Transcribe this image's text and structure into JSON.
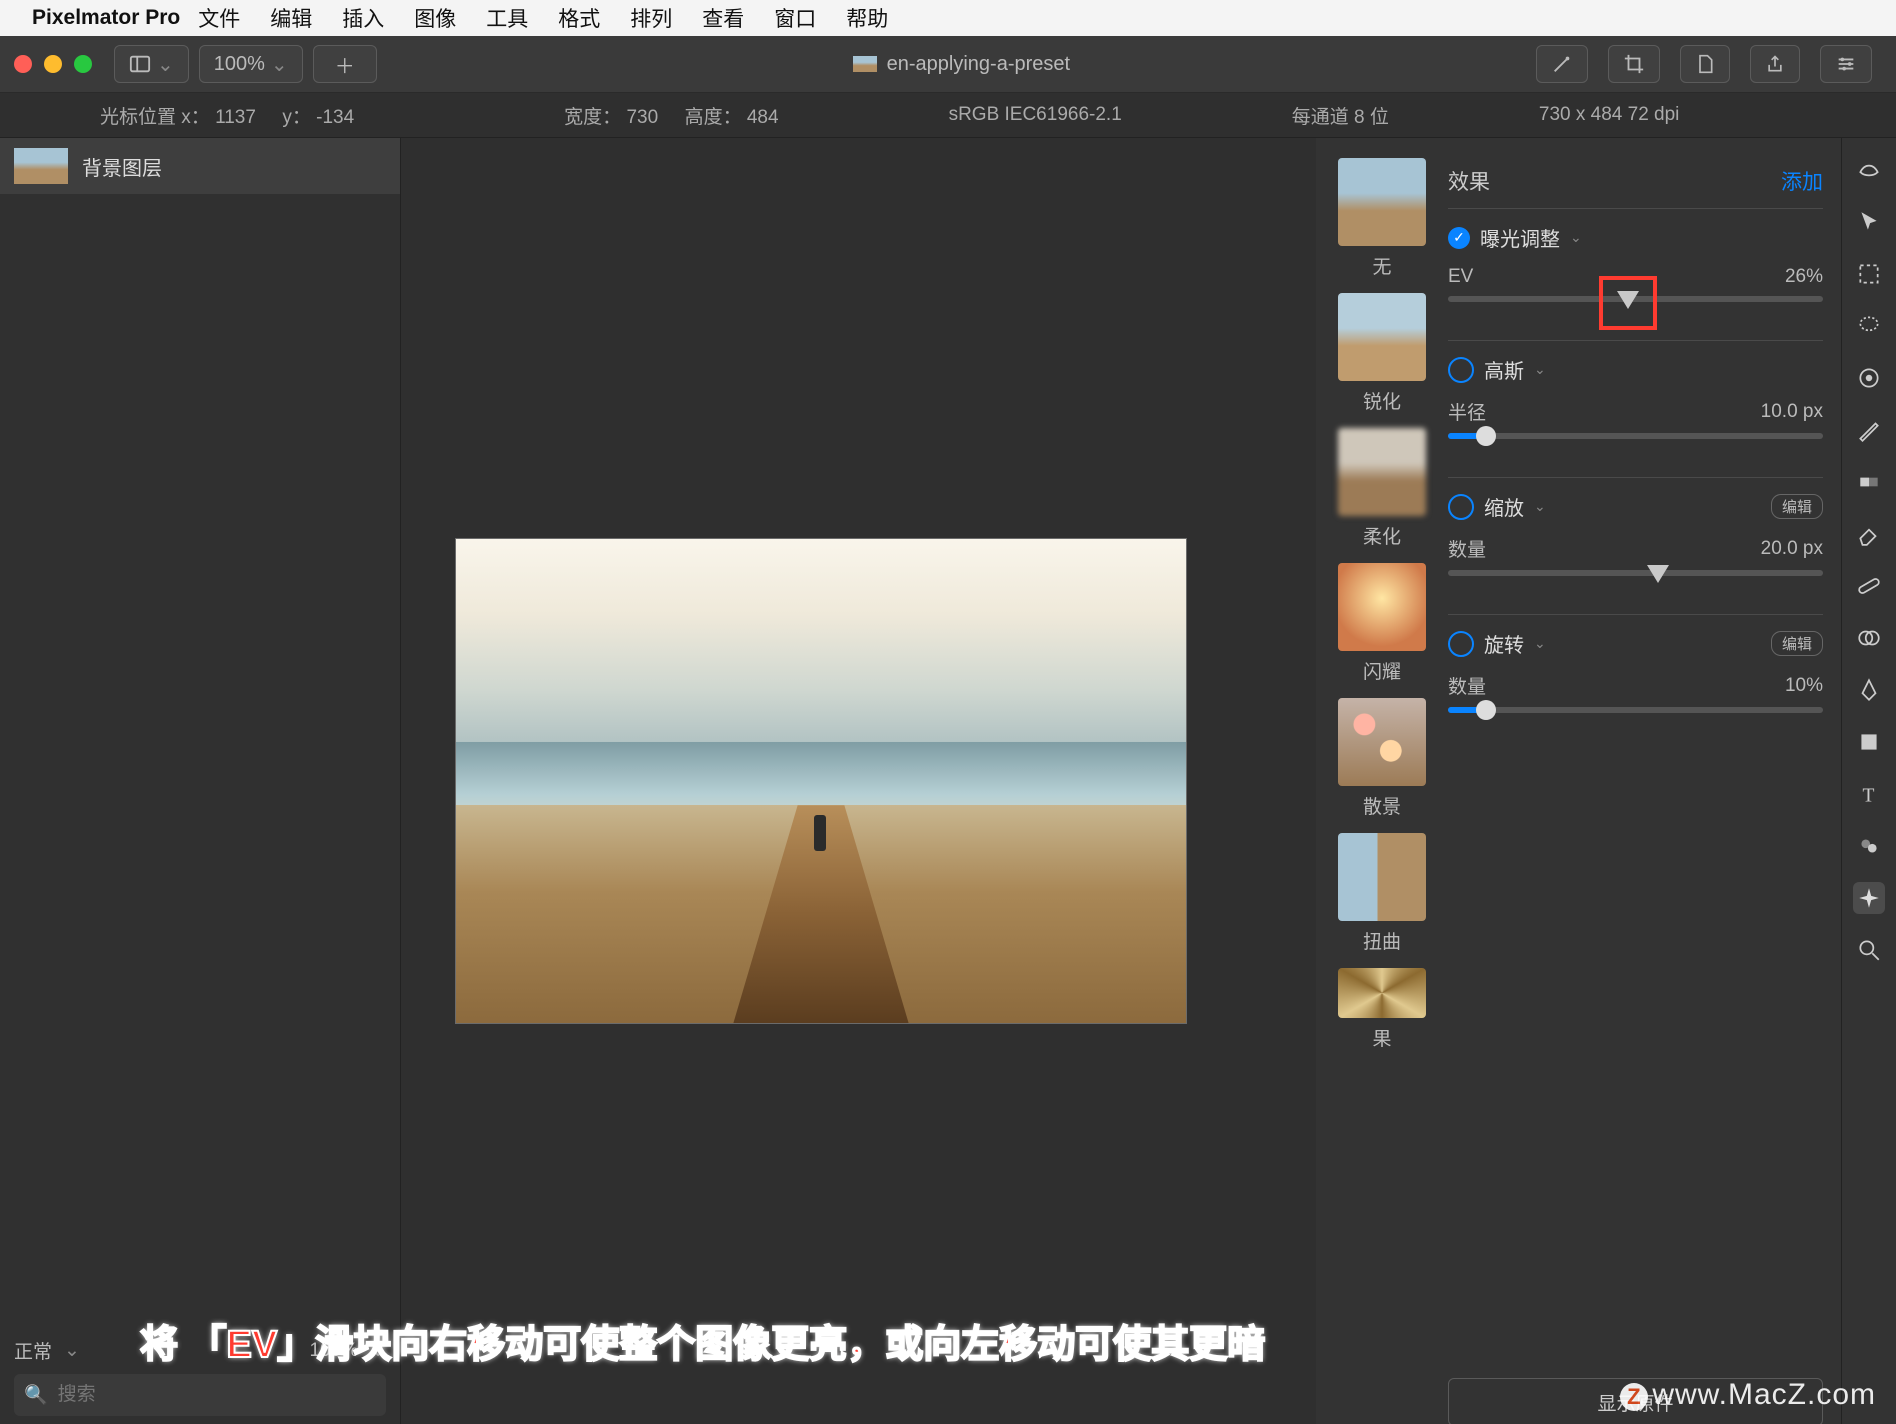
{
  "menubar": {
    "app": "Pixelmator Pro",
    "items": [
      "文件",
      "编辑",
      "插入",
      "图像",
      "工具",
      "格式",
      "排列",
      "查看",
      "窗口",
      "帮助"
    ]
  },
  "toolbar": {
    "zoom": "100%",
    "title": "en-applying-a-preset"
  },
  "info": {
    "cursor_label": "光标位置 x：",
    "cursor_x": "1137",
    "cursor_ylabel": "y：",
    "cursor_y": "-134",
    "w_label": "宽度：",
    "w": "730",
    "h_label": "高度：",
    "h": "484",
    "profile": "sRGB IEC61966-2.1",
    "channel": "每通道 8 位",
    "dims": "730 x 484 72 dpi"
  },
  "layers": {
    "item0": "背景图层",
    "blend": "正常",
    "opacity": "100%",
    "search_placeholder": "搜索"
  },
  "presets": {
    "p0": "无",
    "p1": "锐化",
    "p2": "柔化",
    "p3": "闪耀",
    "p4": "散景",
    "p5": "扭曲",
    "p6": "果"
  },
  "fx": {
    "header": "效果",
    "add": "添加",
    "exposure": {
      "title": "曝光调整",
      "param": "EV",
      "value": "26%",
      "pos": 48
    },
    "gauss": {
      "title": "高斯",
      "param": "半径",
      "value": "10.0 px",
      "pos": 10
    },
    "zoom": {
      "title": "缩放",
      "param": "数量",
      "value": "20.0 px",
      "pos": 56,
      "edit": "编辑"
    },
    "rotate": {
      "title": "旋转",
      "param": "数量",
      "value": "10%",
      "pos": 10,
      "edit": "编辑"
    },
    "show_original": "显示原件"
  },
  "banner": "将 「EV」滑块向右移动可使整个图像更亮，或向左移动可使其更暗",
  "watermark": "www.MacZ.com"
}
